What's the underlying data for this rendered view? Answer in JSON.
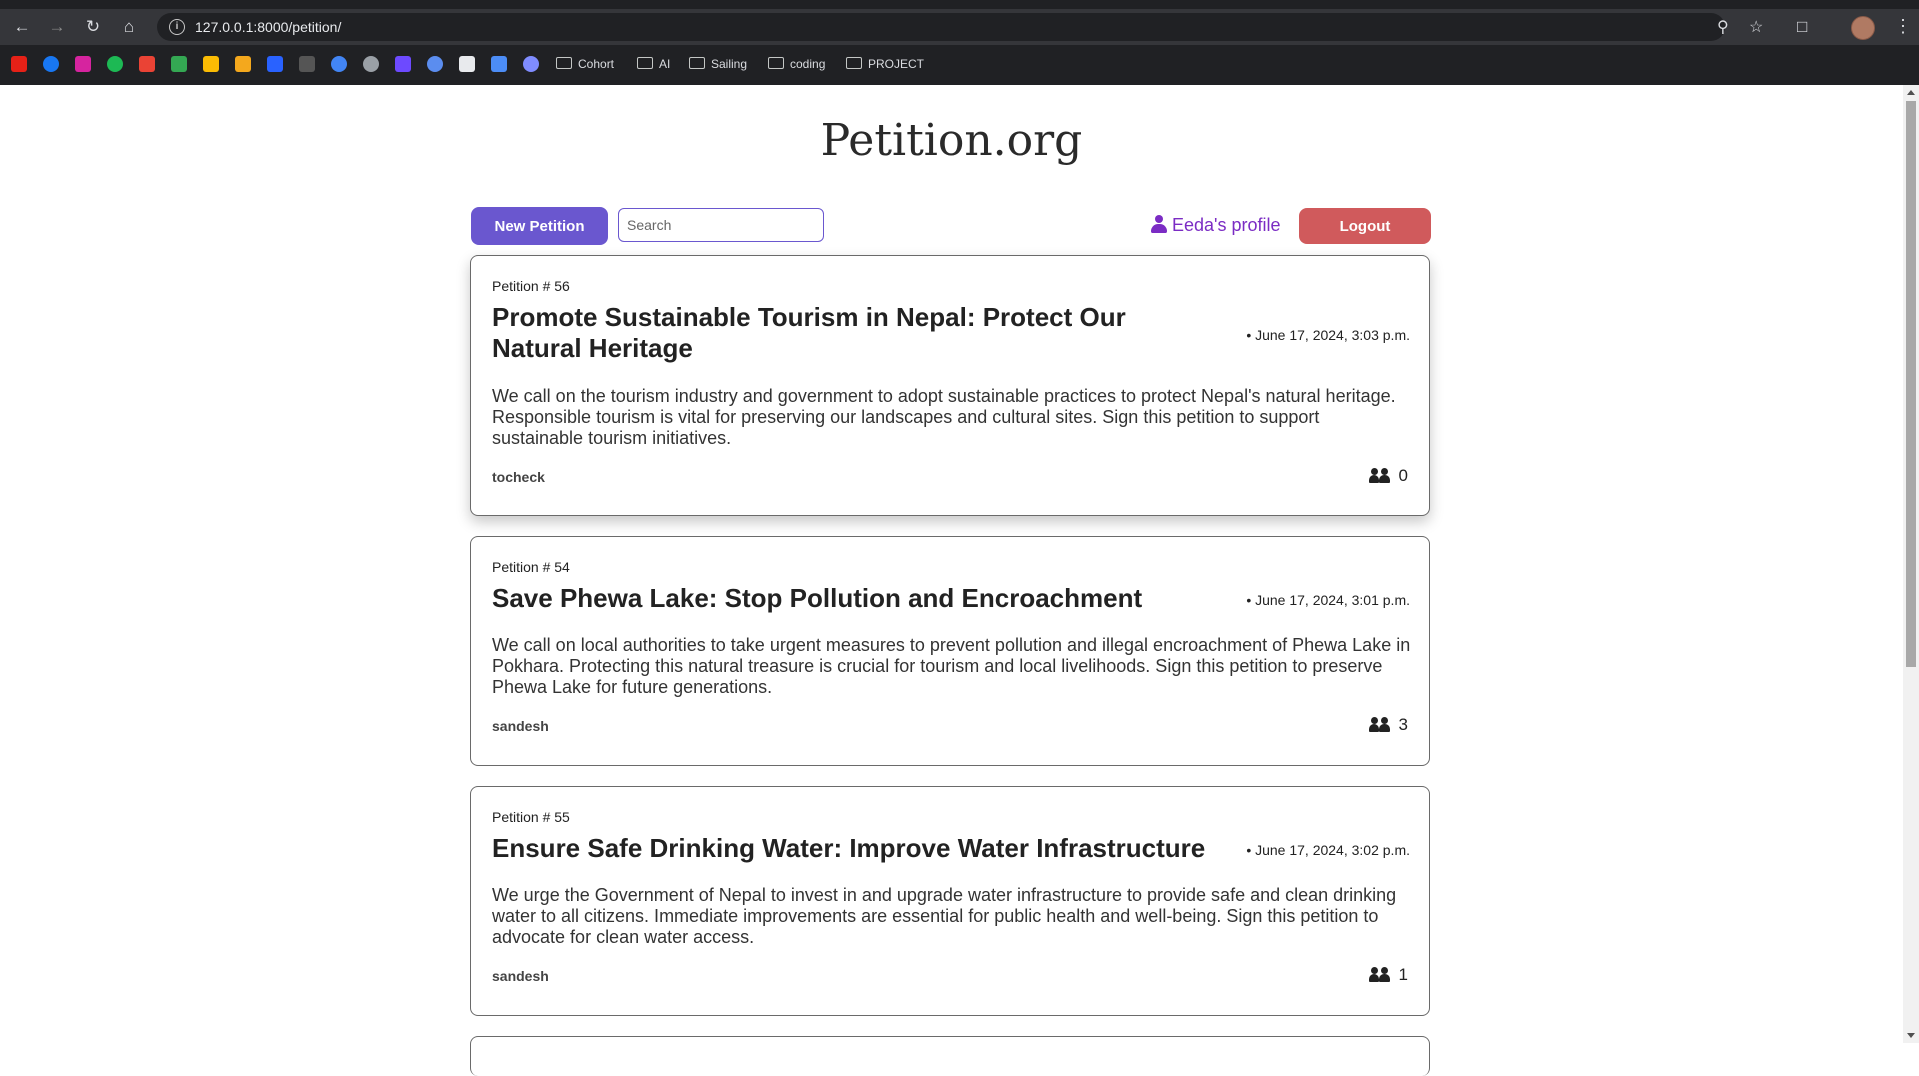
{
  "browser": {
    "url": "127.0.0.1:8000/petition/",
    "bookmark_folders": [
      "Cohort",
      "AI",
      "Sailing",
      "coding",
      "PROJECT"
    ],
    "bookmark_icons": [
      "youtube-icon",
      "facebook-icon",
      "instagram-icon",
      "spotify-icon",
      "gmail-icon",
      "drive-icon",
      "keep-icon",
      "slides-icon",
      "hashnode-icon",
      "notion-icon",
      "chrome-icon",
      "openai-icon",
      "proton-mail-icon",
      "threads-icon",
      "github-icon",
      "gemini-icon",
      "misc-icon"
    ]
  },
  "site": {
    "brand": "Petition.org"
  },
  "toolbar": {
    "new_petition_label": "New Petition",
    "search_placeholder": "Search",
    "profile_label": "Eeda's profile",
    "logout_label": "Logout"
  },
  "petitions": [
    {
      "number": "Petition # 56",
      "title": "Promote Sustainable Tourism in Nepal: Protect Our Natural Heritage",
      "date": "• June 17, 2024, 3:03 p.m.",
      "body": "We call on the tourism industry and government to adopt sustainable practices to protect Nepal's natural heritage. Responsible tourism is vital for preserving our landscapes and cultural sites. Sign this petition to support sustainable tourism initiatives.",
      "author": "tocheck",
      "signatures": "0"
    },
    {
      "number": "Petition # 54",
      "title": "Save Phewa Lake: Stop Pollution and Encroachment",
      "date": "• June 17, 2024, 3:01 p.m.",
      "body": "We call on local authorities to take urgent measures to prevent pollution and illegal encroachment of Phewa Lake in Pokhara. Protecting this natural treasure is crucial for tourism and local livelihoods. Sign this petition to preserve Phewa Lake for future generations.",
      "author": "sandesh",
      "signatures": "3"
    },
    {
      "number": "Petition # 55",
      "title": "Ensure Safe Drinking Water: Improve Water Infrastructure",
      "date": "• June 17, 2024, 3:02 p.m.",
      "body": "We urge the Government of Nepal to invest in and upgrade water infrastructure to provide safe and clean drinking water to all citizens. Immediate improvements are essential for public health and well-being. Sign this petition to advocate for clean water access.",
      "author": "sandesh",
      "signatures": "1"
    }
  ],
  "colors": {
    "accent": "#6a57cf",
    "logout": "#d05a5c",
    "profile": "#7b2cc4"
  }
}
